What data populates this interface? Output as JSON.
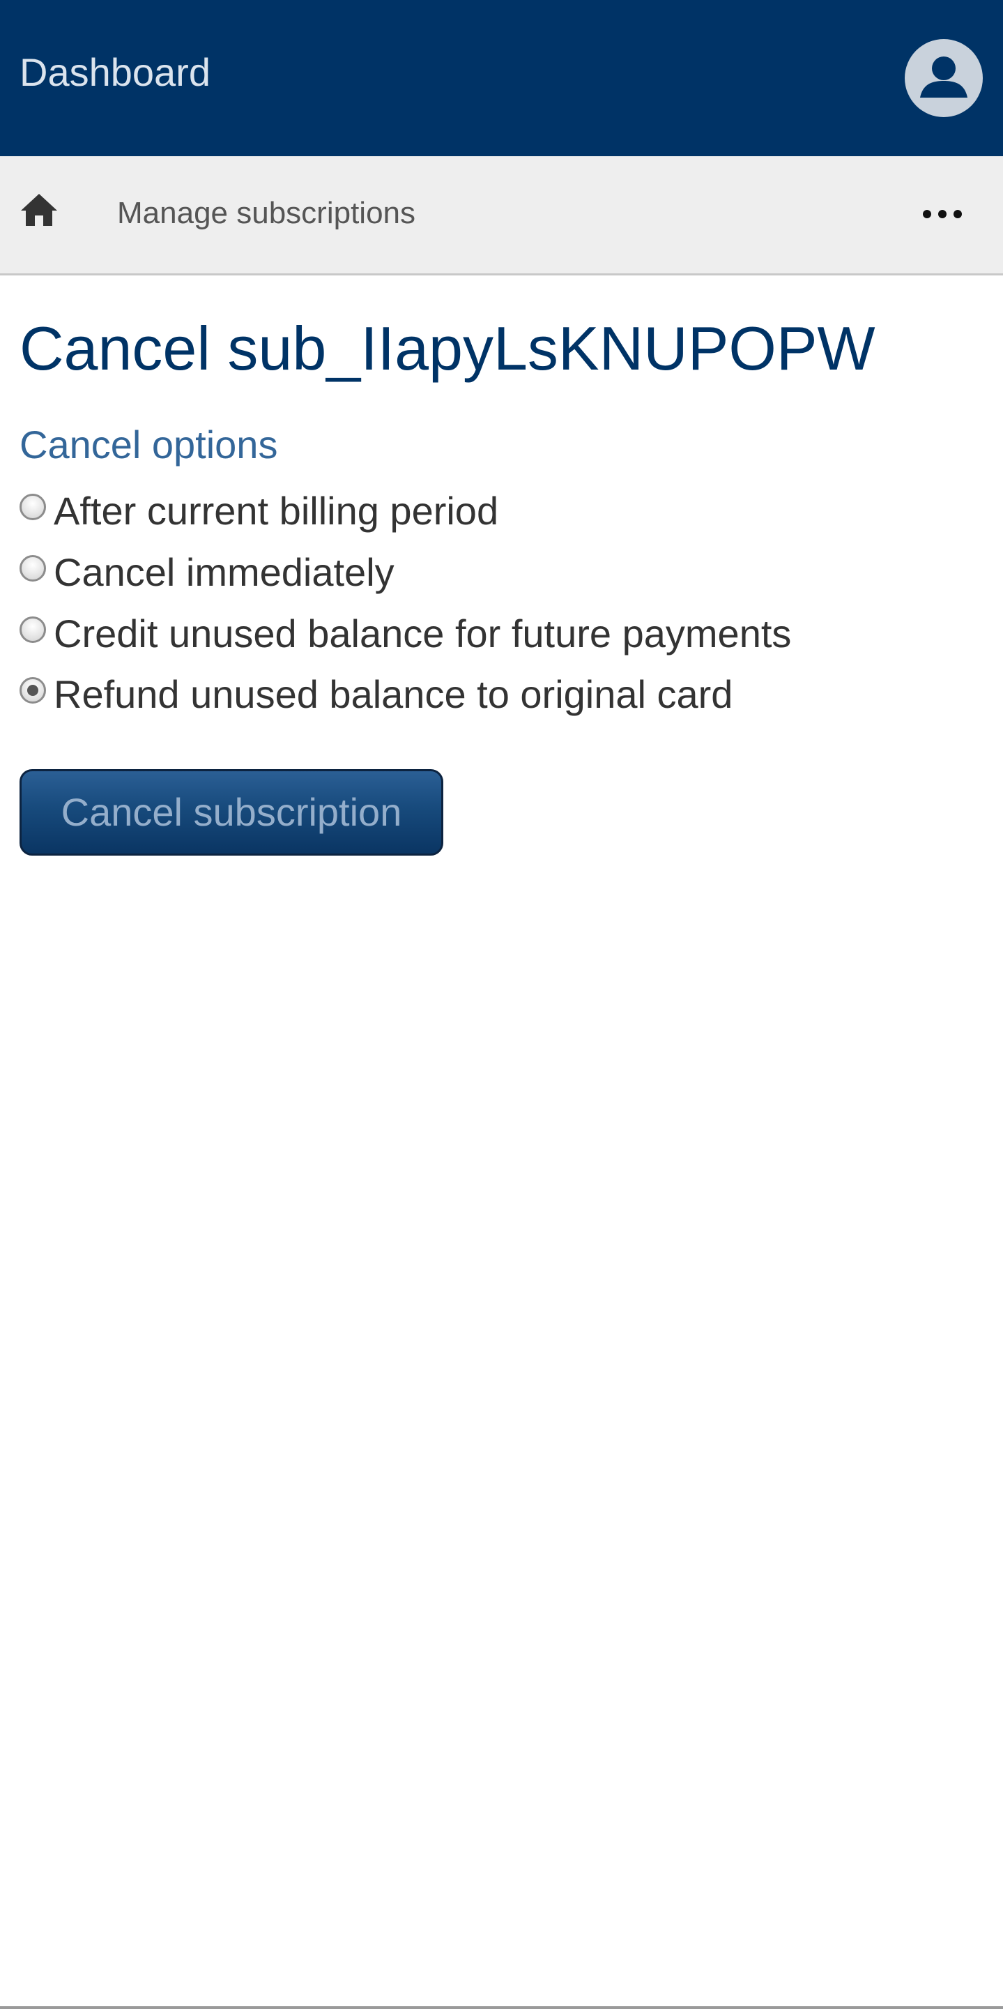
{
  "header": {
    "title": "Dashboard",
    "avatar_icon": "user-avatar-icon",
    "background_color": "#003366"
  },
  "subnav": {
    "home_icon": "home-icon",
    "breadcrumb_label": "Manage subscriptions",
    "more_icon": "more-horizontal-icon"
  },
  "main": {
    "page_title": "Cancel sub_IIapyLsKNUPOPW",
    "section_title": "Cancel options",
    "options": [
      {
        "label": "After current billing period",
        "checked": false
      },
      {
        "label": "Cancel immediately",
        "checked": false
      },
      {
        "label": "Credit unused balance for future payments",
        "checked": false
      },
      {
        "label": "Refund unused balance to original card",
        "checked": true
      }
    ],
    "submit_label": "Cancel subscription"
  },
  "colors": {
    "title": "#003366",
    "section": "#336699",
    "subnav_bg": "#eeeeee"
  }
}
